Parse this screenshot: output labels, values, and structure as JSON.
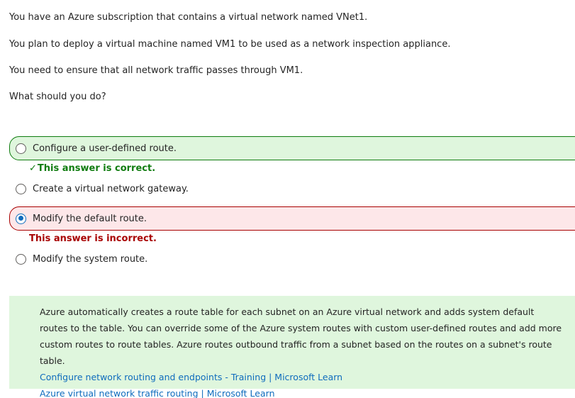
{
  "question": {
    "lines": [
      "You have an Azure subscription that contains a virtual network named VNet1.",
      "You plan to deploy a virtual machine named VM1 to be used as a network inspection appliance.",
      "You need to ensure that all network traffic passes through VM1.",
      "What should you do?"
    ]
  },
  "options": [
    {
      "label": "Configure a user-defined route.",
      "state": "correct",
      "selected": false
    },
    {
      "label": "Create a virtual network gateway.",
      "state": "plain",
      "selected": false
    },
    {
      "label": "Modify the default route.",
      "state": "incorrect",
      "selected": true
    },
    {
      "label": "Modify the system route.",
      "state": "plain",
      "selected": false
    }
  ],
  "feedback": {
    "correct_check": "✓",
    "correct": "This answer is correct.",
    "incorrect": "This answer is incorrect."
  },
  "explanation": {
    "text": "Azure automatically creates a route table for each subnet on an Azure virtual network and adds system default routes to the table. You can override some of the Azure system routes with custom user-defined routes and add more custom routes to route tables. Azure routes outbound traffic from a subnet based on the routes on a subnet's route table.",
    "links": [
      "Configure network routing and endpoints - Training | Microsoft Learn",
      "Azure virtual network traffic routing | Microsoft Learn"
    ]
  },
  "colors": {
    "correct_bg": "#dff6dd",
    "correct_border": "#107c10",
    "incorrect_bg": "#fde7e9",
    "incorrect_border": "#a80000",
    "link": "#0f6cbd",
    "radio_selected": "#0f6cbd"
  }
}
